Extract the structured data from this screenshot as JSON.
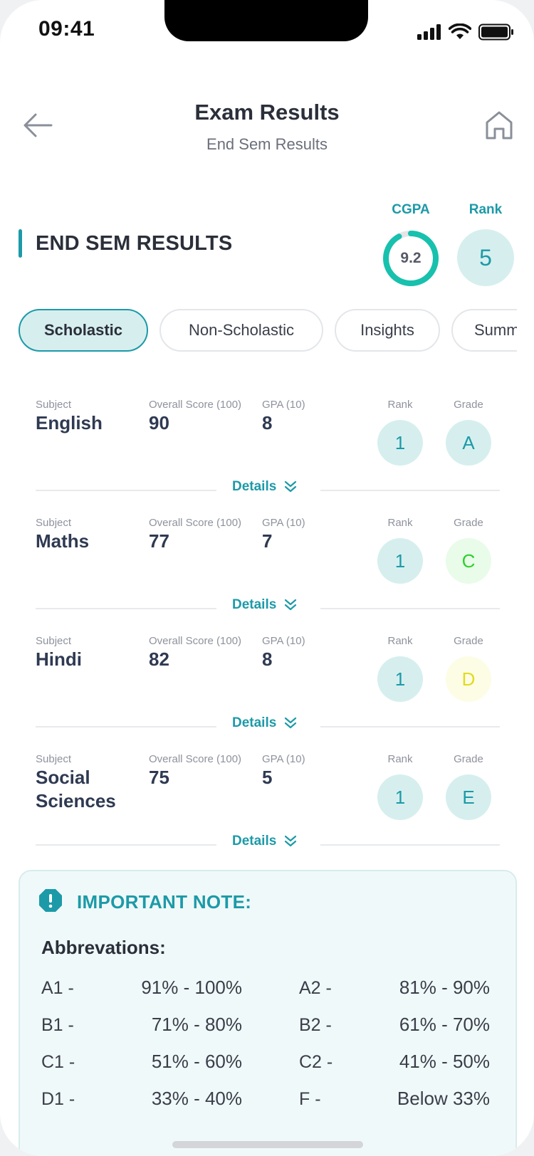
{
  "status_bar": {
    "time": "09:41"
  },
  "header": {
    "title": "Exam Results",
    "subtitle": "End Sem Results"
  },
  "section": {
    "title": "END SEM RESULTS",
    "cgpa_label": "CGPA",
    "cgpa_value": "9.2",
    "cgpa_fraction": 0.92,
    "rank_label": "Rank",
    "rank_value": "5"
  },
  "tabs": [
    {
      "label": "Scholastic",
      "active": true
    },
    {
      "label": "Non-Scholastic",
      "active": false
    },
    {
      "label": "Insights",
      "active": false
    },
    {
      "label": "Summary",
      "active": false
    }
  ],
  "columns": {
    "subject": "Subject",
    "score": "Overall Score (100)",
    "gpa": "GPA (10)",
    "rank": "Rank",
    "grade": "Grade",
    "details": "Details"
  },
  "subjects": [
    {
      "name": "English",
      "score": "90",
      "gpa": "8",
      "rank": "1",
      "grade": "A",
      "grade_bg": "#d6efee",
      "grade_color": "#1c9aa8"
    },
    {
      "name": "Maths",
      "score": "77",
      "gpa": "7",
      "rank": "1",
      "grade": "C",
      "grade_bg": "#e9fbe9",
      "grade_color": "#2bd12b"
    },
    {
      "name": "Hindi",
      "score": "82",
      "gpa": "8",
      "rank": "1",
      "grade": "D",
      "grade_bg": "#fdfde6",
      "grade_color": "#e0dc1f"
    },
    {
      "name": "Social Sciences",
      "score": "75",
      "gpa": "5",
      "rank": "1",
      "grade": "E",
      "grade_bg": "#d6efee",
      "grade_color": "#1c9aa8"
    }
  ],
  "note": {
    "title": "IMPORTANT NOTE:",
    "abbr_title": "Abbrevations:",
    "items": [
      {
        "code": "A1 -",
        "range": "91% - 100%"
      },
      {
        "code": "A2 -",
        "range": "81% - 90%"
      },
      {
        "code": "B1 -",
        "range": "71% - 80%"
      },
      {
        "code": "B2 -",
        "range": "61% - 70%"
      },
      {
        "code": "C1 -",
        "range": "51% - 60%"
      },
      {
        "code": "C2 -",
        "range": "41% - 50%"
      },
      {
        "code": "D1 -",
        "range": "33% - 40%"
      },
      {
        "code": "F -",
        "range": "Below 33%"
      }
    ]
  },
  "colors": {
    "accent": "#1c9aa8",
    "accent_light": "#d6efee",
    "ring_track": "#e3e5e8"
  }
}
